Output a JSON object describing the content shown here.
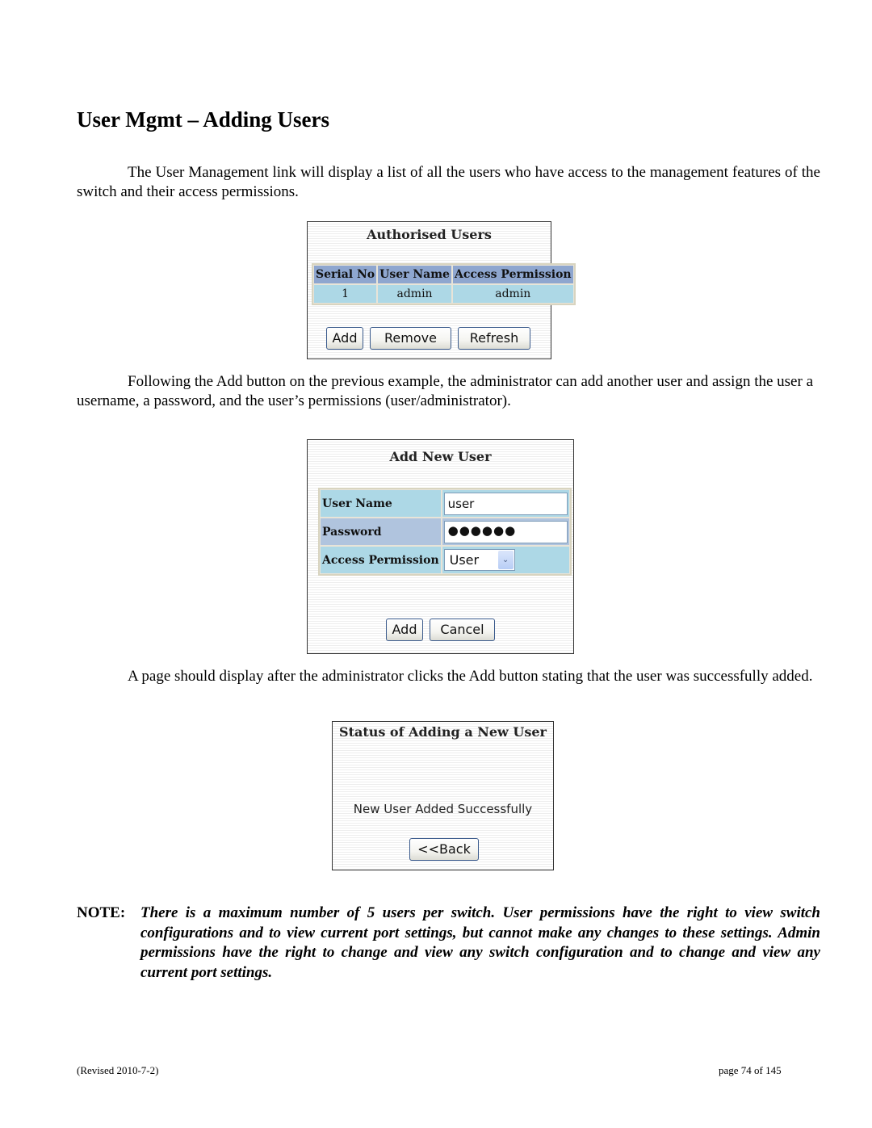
{
  "document": {
    "title": "User Mgmt – Adding Users",
    "paragraph1": "The User Management link will display a list of all the users who have access to the management features of the switch and their access permissions.",
    "paragraph2": "Following the Add button on the previous example, the administrator can add another user and assign the user a username, a password, and the user’s permissions (user/administrator).",
    "paragraph3": "A page should display after the administrator clicks the Add button stating that the user was successfully added.",
    "note_label": "NOTE:",
    "note_text": "There is a maximum number of 5 users per switch.  User permissions have the right to view switch configurations and to view current port settings, but cannot make any changes to these settings.  Admin permissions have the right to change and view any switch configuration and to change and view any current port settings."
  },
  "authorised_users": {
    "title": "Authorised Users",
    "columns": [
      "Serial No",
      "User Name",
      "Access Permission"
    ],
    "rows": [
      {
        "serial": "1",
        "user_name": "admin",
        "access": "admin"
      }
    ],
    "buttons": {
      "add": "Add",
      "remove": "Remove",
      "refresh": "Refresh"
    }
  },
  "add_new_user": {
    "title": "Add New User",
    "fields": {
      "user_name_label": "User Name",
      "user_name_value": "user",
      "password_label": "Password",
      "password_value": "●●●●●●",
      "access_label": "Access Permission",
      "access_value": "User"
    },
    "buttons": {
      "add": "Add",
      "cancel": "Cancel"
    }
  },
  "status": {
    "title": "Status of Adding a New User",
    "message": "New User Added Successfully",
    "back_button": "<<Back"
  },
  "footer": {
    "revised": "(Revised 2010-7-2)",
    "page": "page 74 of 145"
  },
  "colors": {
    "header_blue": "#8ea6cf",
    "row_light_blue": "#add8e6",
    "row_steel_blue": "#b0c4de",
    "button_border": "#3a5a8c"
  }
}
